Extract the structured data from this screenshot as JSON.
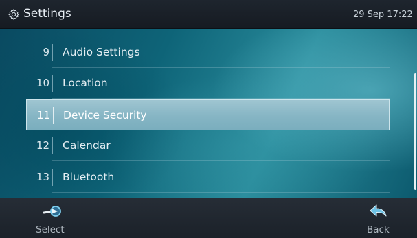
{
  "header": {
    "title": "Settings",
    "datetime": "29 Sep 17:22",
    "icon": "gear-icon"
  },
  "menu": {
    "items": [
      {
        "number": "9",
        "label": "Audio Settings",
        "selected": false
      },
      {
        "number": "10",
        "label": "Location",
        "selected": false
      },
      {
        "number": "11",
        "label": "Device Security",
        "selected": true
      },
      {
        "number": "12",
        "label": "Calendar",
        "selected": false
      },
      {
        "number": "13",
        "label": "Bluetooth",
        "selected": false
      }
    ]
  },
  "softkeys": {
    "select": {
      "label": "Select",
      "icon": "select-arrow-icon"
    },
    "back": {
      "label": "Back",
      "icon": "back-arrow-icon"
    }
  },
  "colors": {
    "selection_highlight": "#8fbccb",
    "accent_icon": "#6ec3e6"
  }
}
